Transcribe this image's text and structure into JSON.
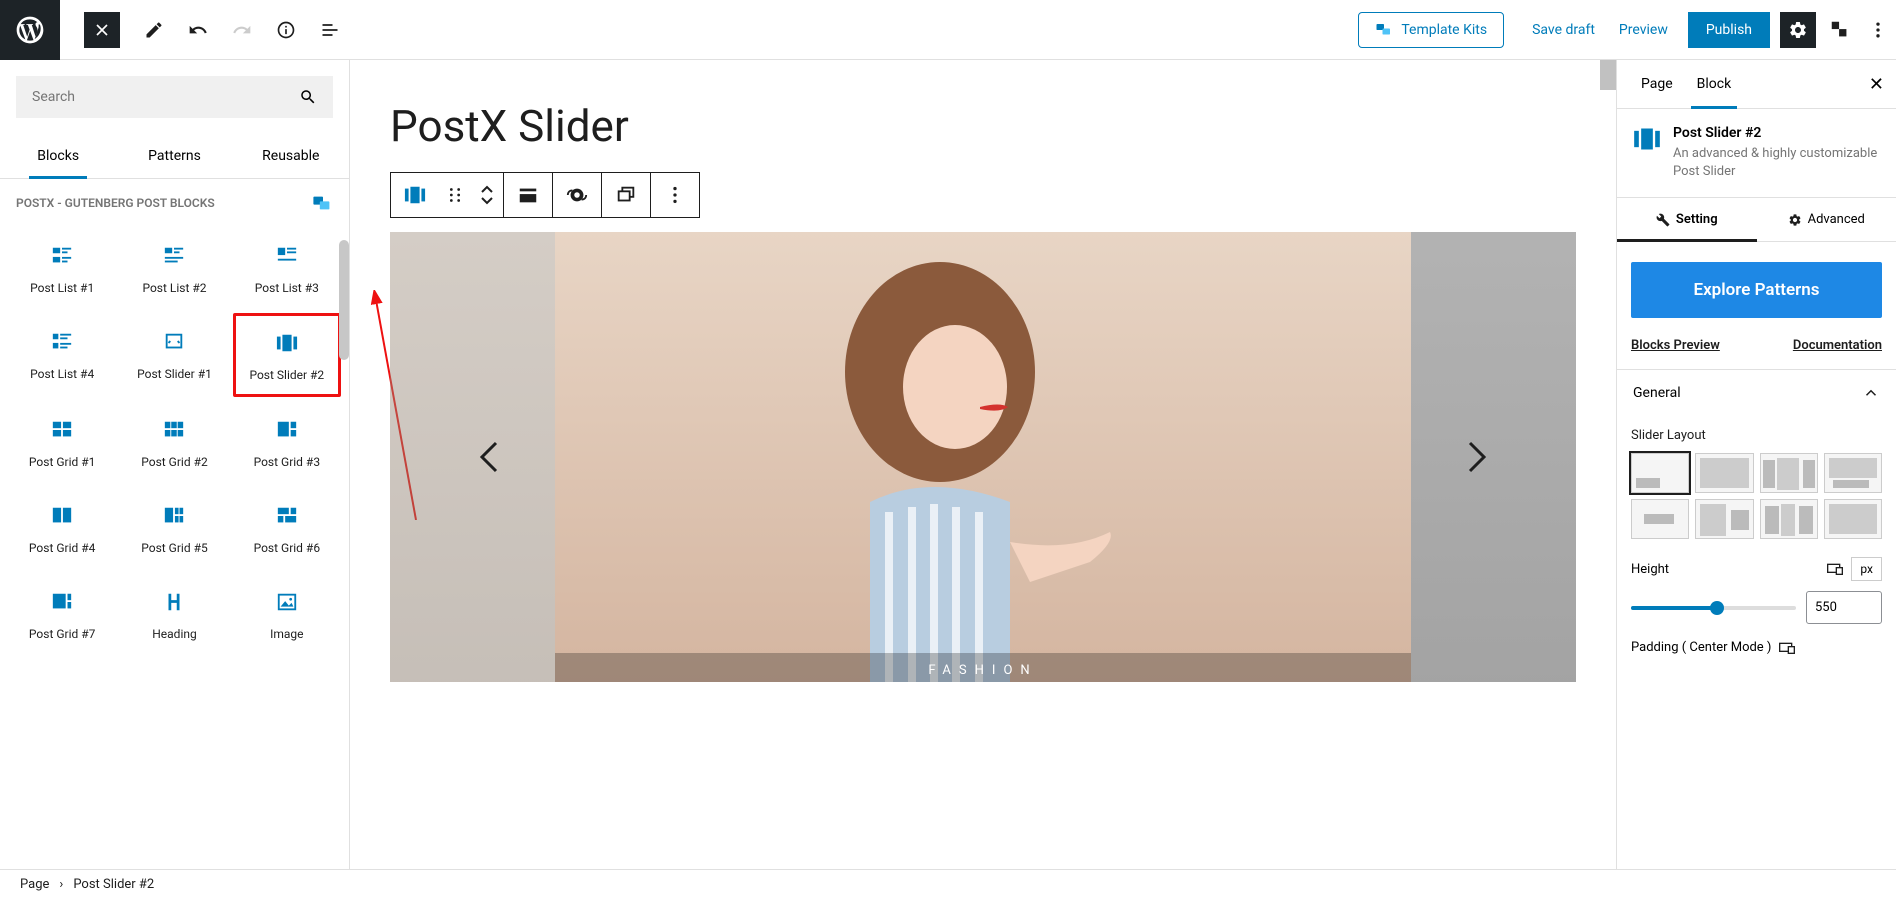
{
  "topbar": {
    "template_kits": "Template Kits",
    "save_draft": "Save draft",
    "preview": "Preview",
    "publish": "Publish"
  },
  "left_panel": {
    "search_placeholder": "Search",
    "tabs": {
      "blocks": "Blocks",
      "patterns": "Patterns",
      "reusable": "Reusable"
    },
    "category": "POSTX - GUTENBERG POST BLOCKS",
    "blocks": [
      "Post List #1",
      "Post List #2",
      "Post List #3",
      "Post List #4",
      "Post Slider #1",
      "Post Slider #2",
      "Post Grid #1",
      "Post Grid #2",
      "Post Grid #3",
      "Post Grid #4",
      "Post Grid #5",
      "Post Grid #6",
      "Post Grid #7",
      "Heading",
      "Image"
    ]
  },
  "canvas": {
    "title": "PostX Slider",
    "caption": "FASHION"
  },
  "right_panel": {
    "tabs": {
      "page": "Page",
      "block": "Block"
    },
    "block_title": "Post Slider #2",
    "block_desc": "An advanced & highly customizable Post Slider",
    "subtabs": {
      "setting": "Setting",
      "advanced": "Advanced"
    },
    "explore": "Explore Patterns",
    "links": {
      "preview": "Blocks Preview",
      "docs": "Documentation"
    },
    "accordion": {
      "general": "General"
    },
    "slider_layout_label": "Slider Layout",
    "height_label": "Height",
    "height_unit": "px",
    "height_value": "550",
    "padding_label": "Padding ( Center Mode )"
  },
  "breadcrumb": {
    "root": "Page",
    "current": "Post Slider #2"
  }
}
